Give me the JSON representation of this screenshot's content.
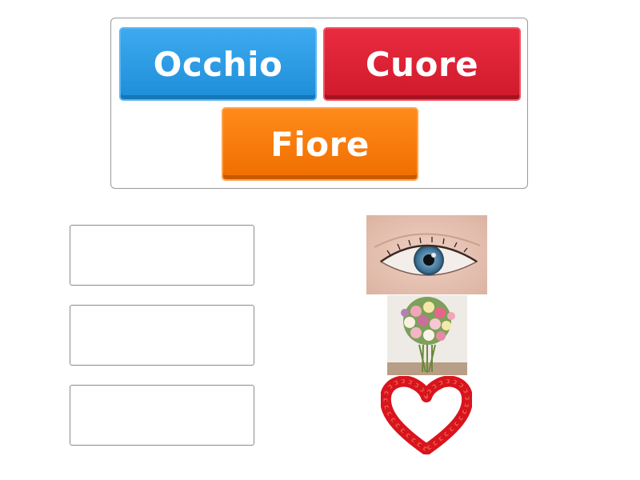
{
  "word_bank": {
    "tiles": [
      {
        "label": "Occhio",
        "color": "#2a9de6"
      },
      {
        "label": "Cuore",
        "color": "#dc2436"
      },
      {
        "label": "Fiore",
        "color": "#f77b0c"
      }
    ]
  },
  "targets": [
    {
      "image": "eye-image",
      "answer_value": ""
    },
    {
      "image": "flower-bouquet-image",
      "answer_value": ""
    },
    {
      "image": "heart-of-petals-image",
      "answer_value": ""
    }
  ],
  "colors": {
    "border": "#9a9a9a",
    "background": "#ffffff"
  }
}
